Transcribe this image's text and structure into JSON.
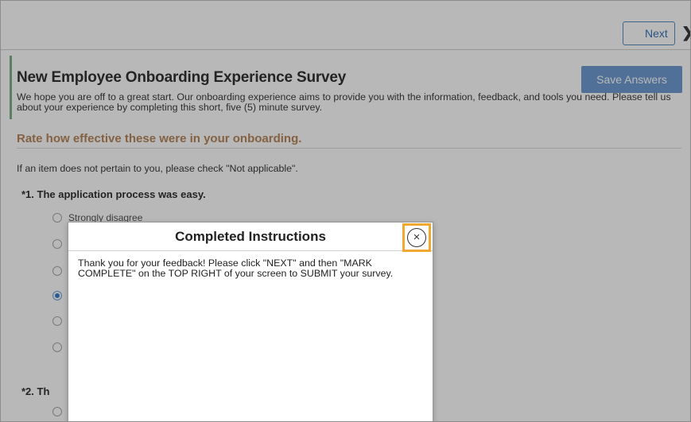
{
  "toolbar": {
    "next_label": "Next",
    "next_chevron": "❯"
  },
  "survey": {
    "title": "New Employee Onboarding Experience Survey",
    "save_label": "Save Answers",
    "intro": "We hope you are off to a great start. Our onboarding experience aims to provide you with the information, feedback, and tools you need.  Please tell us about your experience by completing this short, five (5) minute survey.",
    "section_heading": "Rate how effective these were in your onboarding.",
    "note": "If an item does not pertain to you, please check \"Not applicable\".",
    "questions": [
      {
        "label": "*1.  The application process was easy.",
        "first_option": "Strongly disagree",
        "selected_index": 3
      },
      {
        "label": "*2.  Th"
      }
    ]
  },
  "modal": {
    "title": "Completed Instructions",
    "close_symbol": "×",
    "message": "Thank you for your feedback! Please click \"NEXT\" and then \"MARK COMPLETE\" on the TOP RIGHT of your screen to SUBMIT your survey."
  },
  "icons": {
    "next": "chevron-right-icon",
    "close": "close-icon"
  },
  "colors": {
    "primary_button": "#6f9cd1",
    "section_heading": "#b8875c",
    "focus_ring": "#f0a830",
    "accent_bar": "#7fb08a"
  }
}
